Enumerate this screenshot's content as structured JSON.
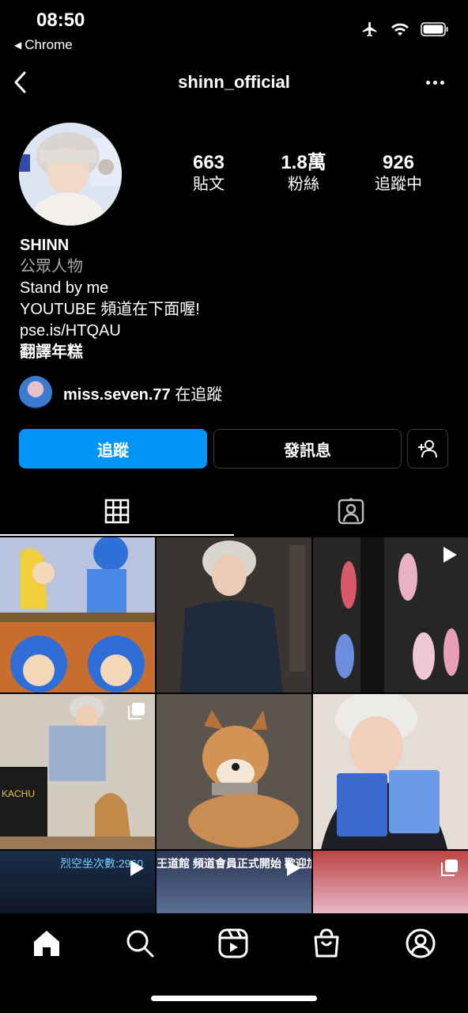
{
  "status_bar": {
    "time": "08:50",
    "back_app_label": "Chrome",
    "icons": [
      "airplane-icon",
      "wifi-icon",
      "battery-icon"
    ]
  },
  "nav": {
    "username": "shinn_official",
    "back_icon": "chevron-left-icon",
    "more_icon": "more-horizontal-icon"
  },
  "profile": {
    "stats": [
      {
        "value": "663",
        "label": "貼文"
      },
      {
        "value": "1.8萬",
        "label": "粉絲"
      },
      {
        "value": "926",
        "label": "追蹤中"
      }
    ],
    "display_name": "SHINN",
    "category": "公眾人物",
    "bio_lines": [
      "Stand by me",
      "YOUTUBE 頻道在下面喔!",
      "pse.is/HTQAU"
    ],
    "bio_bold": "翻譯年糕",
    "mutual_user": "miss.seven.77",
    "mutual_suffix": " 在追蹤"
  },
  "actions": {
    "follow_label": "追蹤",
    "message_label": "發訊息",
    "add_user_icon": "add-user-icon"
  },
  "tabs": [
    "grid-icon",
    "tagged-icon"
  ],
  "grid": {
    "captions": {
      "cell7": "烈空坐次數:2960",
      "cell8": "王道館  頻道會員正式開始 歡迎加"
    }
  },
  "bottom_nav": [
    "home-icon",
    "search-icon",
    "reels-icon",
    "shop-icon",
    "profile-icon"
  ],
  "colors": {
    "background": "#000000",
    "follow_button": "#0095f6",
    "secondary_text": "#a8a8a8"
  }
}
